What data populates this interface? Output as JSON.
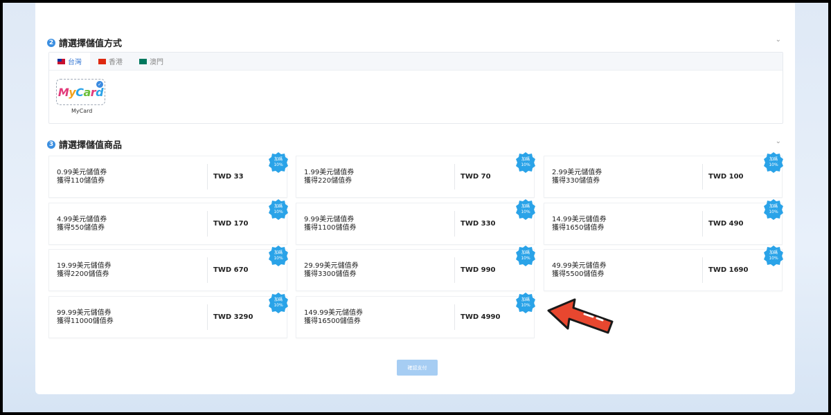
{
  "section2": {
    "number": "2",
    "title": "請選擇儲值方式"
  },
  "tabs": [
    {
      "label": "台灣",
      "flag": "tw"
    },
    {
      "label": "香港",
      "flag": "hk"
    },
    {
      "label": "澳門",
      "flag": "mo"
    }
  ],
  "method": {
    "logo_text": "MyCard",
    "label": "MyCard"
  },
  "section3": {
    "number": "3",
    "title": "請選擇儲值商品"
  },
  "badge": {
    "line1": "加碼",
    "line2": "10%"
  },
  "products": [
    {
      "line1": "0.99美元儲值券",
      "line2": "獲得110儲值券",
      "price": "TWD 33"
    },
    {
      "line1": "1.99美元儲值券",
      "line2": "獲得220儲值券",
      "price": "TWD 70"
    },
    {
      "line1": "2.99美元儲值券",
      "line2": "獲得330儲值券",
      "price": "TWD 100"
    },
    {
      "line1": "4.99美元儲值券",
      "line2": "獲得550儲值券",
      "price": "TWD 170"
    },
    {
      "line1": "9.99美元儲值券",
      "line2": "獲得1100儲值券",
      "price": "TWD 330"
    },
    {
      "line1": "14.99美元儲值券",
      "line2": "獲得1650儲值券",
      "price": "TWD 490"
    },
    {
      "line1": "19.99美元儲值券",
      "line2": "獲得2200儲值券",
      "price": "TWD 670"
    },
    {
      "line1": "29.99美元儲值券",
      "line2": "獲得3300儲值券",
      "price": "TWD 990"
    },
    {
      "line1": "49.99美元儲值券",
      "line2": "獲得5500儲值券",
      "price": "TWD 1690"
    },
    {
      "line1": "99.99美元儲值券",
      "line2": "獲得11000儲值券",
      "price": "TWD 3290"
    },
    {
      "line1": "149.99美元儲值券",
      "line2": "獲得16500儲值券",
      "price": "TWD 4990"
    }
  ],
  "confirm_label": "確認支付",
  "colors": {
    "accent": "#3a8ae0",
    "badge": "#2aa3e8",
    "arrow": "#e8472f",
    "confirm": "#a6cdf3"
  }
}
